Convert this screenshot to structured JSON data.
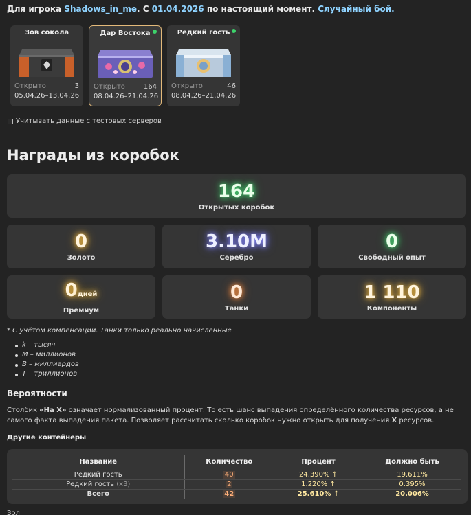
{
  "header": {
    "prefix": "Для игрока",
    "player": "Shadows_in_me",
    "mid": ". С",
    "date": "01.04.2026",
    "suffix": "по настоящий момент.",
    "mode": "Случайный бой."
  },
  "cases": [
    {
      "title": "Зов сокола",
      "opened_label": "Открыто",
      "opened": "3",
      "date_from": "05.04.26",
      "dash": "–",
      "date_to": "13.04.26",
      "selected": false,
      "dot": false
    },
    {
      "title": "Дар Востока",
      "opened_label": "Открыто",
      "opened": "164",
      "date_from": "08.04.26",
      "dash": "–",
      "date_to": "21.04.26",
      "selected": true,
      "dot": true
    },
    {
      "title": "Редкий гость",
      "opened_label": "Открыто",
      "opened": "46",
      "date_from": "08.04.26",
      "dash": "–",
      "date_to": "21.04.26",
      "selected": false,
      "dot": true
    }
  ],
  "test_servers_label": "Учитывать данные с тестовых серверов",
  "rewards_title": "Награды из коробок",
  "stats": {
    "boxes": {
      "value": "164",
      "label": "Открытых коробок"
    },
    "gold": {
      "value": "0",
      "label": "Золото"
    },
    "silver": {
      "value": "3.10M",
      "label": "Серебро"
    },
    "free_xp": {
      "value": "0",
      "label": "Свободный опыт"
    },
    "premium": {
      "value": "0",
      "unit": "дней",
      "label": "Премиум"
    },
    "tanks": {
      "value": "0",
      "label": "Танки"
    },
    "components": {
      "value": "1 110",
      "label": "Компоненты"
    }
  },
  "note": "* С учётом компенсаций. Танки только реально начисленные",
  "legend": [
    "k – тысяч",
    "M – миллионов",
    "B – миллиардов",
    "T – триллионов"
  ],
  "probabilities_title": "Вероятности",
  "paragraph": {
    "p1": "Столбик ",
    "bold1": "«На X»",
    "p2": " означает нормализованный процент. То есть шанс выпадения определённого количества ресурсов, а не самого факта выпадения пакета. Позволяет рассчитать сколько коробок нужно открыть для получения ",
    "bold2": "X",
    "p3": " ресурсов."
  },
  "other_containers_title": "Другие контейнеры",
  "table": {
    "headers": [
      "Название",
      "Количество",
      "Процент",
      "Должно быть"
    ],
    "rows": [
      {
        "name": "Редкий гость",
        "extra": "",
        "qty": "40",
        "pct": "24.390% ↑",
        "expected": "19.611%"
      },
      {
        "name": "Редкий гость",
        "extra": "(x3)",
        "qty": "2",
        "pct": "1.220% ↑",
        "expected": "0.395%"
      }
    ],
    "total": {
      "name": "Всего",
      "qty": "42",
      "pct": "25.610% ↑",
      "expected": "20.006%"
    }
  },
  "cut_heading": "Зол"
}
